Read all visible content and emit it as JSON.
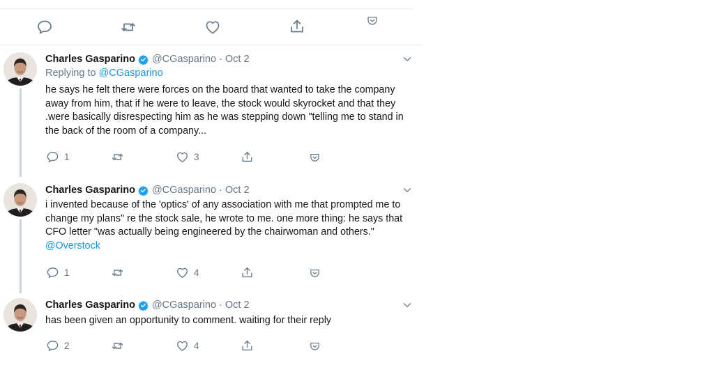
{
  "tweets": [
    {
      "name": "Charles Gasparino",
      "handle": "@CGasparino",
      "separator": "·",
      "date": "Oct 2",
      "replying_prefix": "Replying to",
      "replying_to": "@CGasparino",
      "text": "he says he felt there were forces on the board that wanted to take the company away from him, that if he were to leave, the stock would skyrocket and that they .were basically disrespecting him as he was stepping down \"telling me to stand in the back of the room of a company...",
      "replies": "1",
      "retweets": "",
      "likes": "3"
    },
    {
      "name": "Charles Gasparino",
      "handle": "@CGasparino",
      "separator": "·",
      "date": "Oct 2",
      "text": "i invented because of the 'optics' of any association with me that prompted me to change my plans\" re the stock sale, he wrote to me. one more thing: he says that CFO letter \"was actually being engineered by the chairwoman and others.\"",
      "mention": "@Overstock",
      "replies": "1",
      "retweets": "",
      "likes": "4"
    },
    {
      "name": "Charles Gasparino",
      "handle": "@CGasparino",
      "separator": "·",
      "date": "Oct 2",
      "text": "has been given an opportunity to comment. waiting for their reply",
      "replies": "2",
      "retweets": "",
      "likes": "4"
    }
  ],
  "icons": {
    "reply": "reply-icon",
    "retweet": "retweet-icon",
    "like": "heart-icon",
    "share": "share-icon",
    "save": "pocket-icon",
    "menu": "chevron-down-icon",
    "verified": "verified-badge-icon"
  },
  "colors": {
    "link": "#1b95e0",
    "muted": "#657786",
    "text": "#14171a",
    "verified": "#1da1f2",
    "thread_line": "#ccd6dd",
    "divider": "#e6ecf0"
  }
}
